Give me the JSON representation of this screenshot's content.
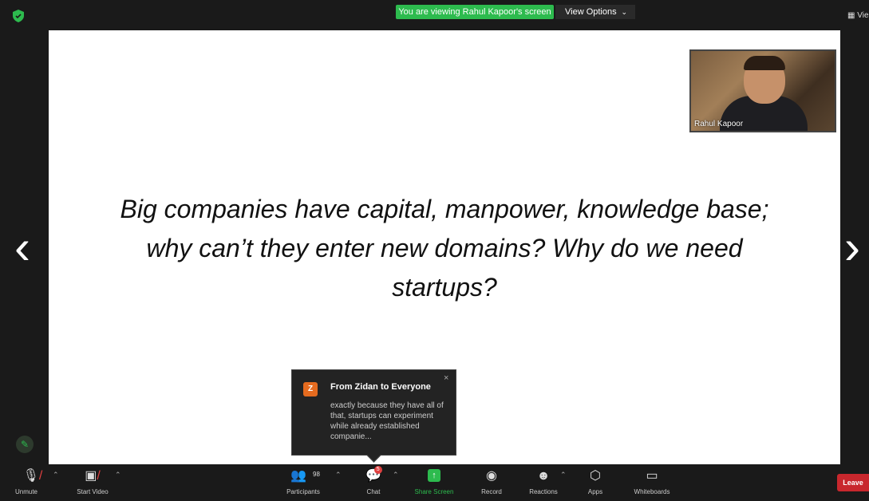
{
  "topbar": {
    "viewing_text": "You are viewing Rahul Kapoor's screen",
    "view_options_label": "View Options",
    "right_label": "Vie"
  },
  "slide": {
    "lines": [
      "Big companies have capital, manpower, knowledge base;",
      "why can’t they enter new domains? Why do we need",
      "startups?"
    ]
  },
  "video": {
    "name": "Rahul Kapoor"
  },
  "chat_toast": {
    "avatar_letter": "Z",
    "from": "From Zidan to Everyone",
    "message": "exactly because they have all of that, startups can experiment while already established companie...",
    "close": "×"
  },
  "nav": {
    "prev": "‹",
    "next": "›"
  },
  "toolbar": {
    "unmute": "Unmute",
    "start_video": "Start Video",
    "participants": "Participants",
    "participants_count": "98",
    "chat": "Chat",
    "chat_badge": "5",
    "share_screen": "Share Screen",
    "record": "Record",
    "reactions": "Reactions",
    "apps": "Apps",
    "whiteboards": "Whiteboards",
    "leave": "Leave"
  },
  "colors": {
    "accent_green": "#2dbb4e",
    "leave_red": "#c8272d",
    "avatar_orange": "#e56b1f"
  }
}
